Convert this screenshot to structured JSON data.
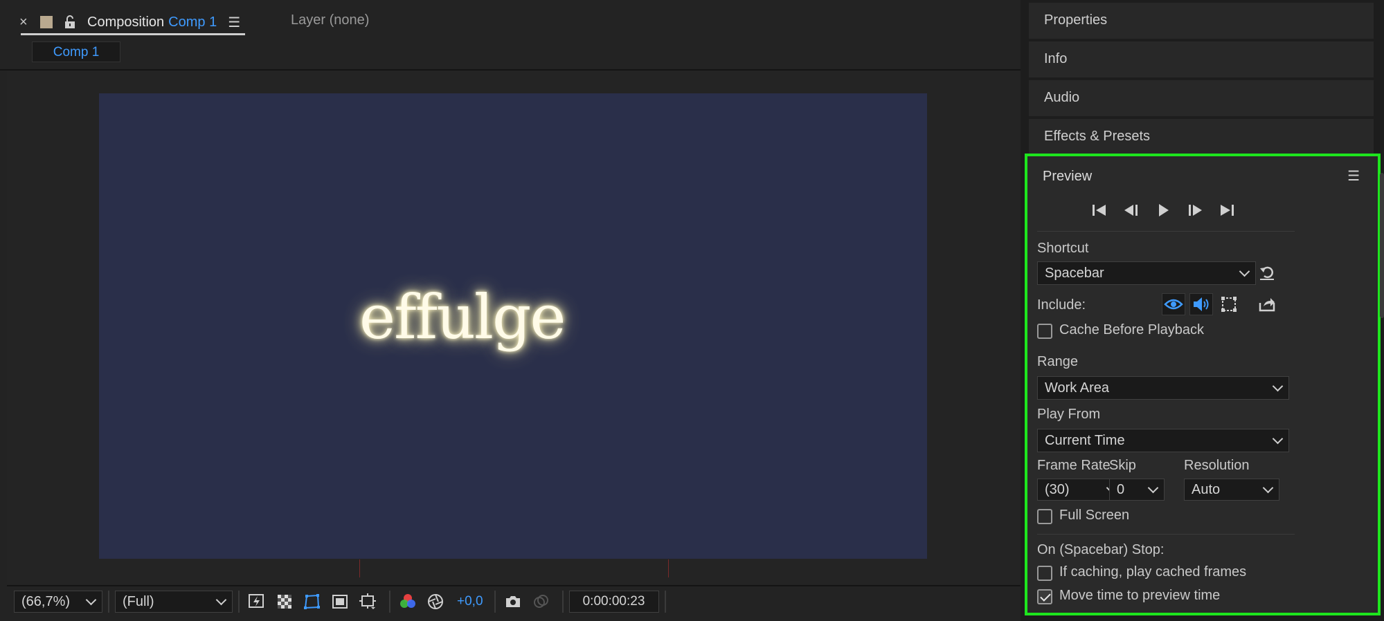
{
  "comp_panel": {
    "tab_label": "Composition",
    "comp_name": "Comp 1",
    "layer_tab": "Layer (none)",
    "breadcrumb": "Comp 1",
    "canvas_text": "effulge",
    "toolbar": {
      "zoom": "(66,7%)",
      "resolution": "(Full)",
      "exposure": "+0,0",
      "timecode": "0:00:00:23"
    }
  },
  "right_panels": {
    "collapsed": [
      "Properties",
      "Info",
      "Audio",
      "Effects & Presets"
    ]
  },
  "preview": {
    "title": "Preview",
    "shortcut_label": "Shortcut",
    "shortcut_value": "Spacebar",
    "include_label": "Include:",
    "cache_before_playback": "Cache Before Playback",
    "range_label": "Range",
    "range_value": "Work Area",
    "play_from_label": "Play From",
    "play_from_value": "Current Time",
    "frame_rate_label": "Frame Rate",
    "skip_label": "Skip",
    "resolution_label": "Resolution",
    "frame_rate_value": "(30)",
    "skip_value": "0",
    "resolution_value": "Auto",
    "full_screen": "Full Screen",
    "on_stop_label": "On (Spacebar) Stop:",
    "if_caching": "If caching, play cached frames",
    "move_time": "Move time to preview time",
    "checks": {
      "cache_before_playback": false,
      "full_screen": false,
      "if_caching": false,
      "move_time": true
    }
  },
  "colors": {
    "accent": "#3f9bff",
    "highlight_border": "#1ee51e",
    "canvas_bg": "#2a2f4a"
  }
}
